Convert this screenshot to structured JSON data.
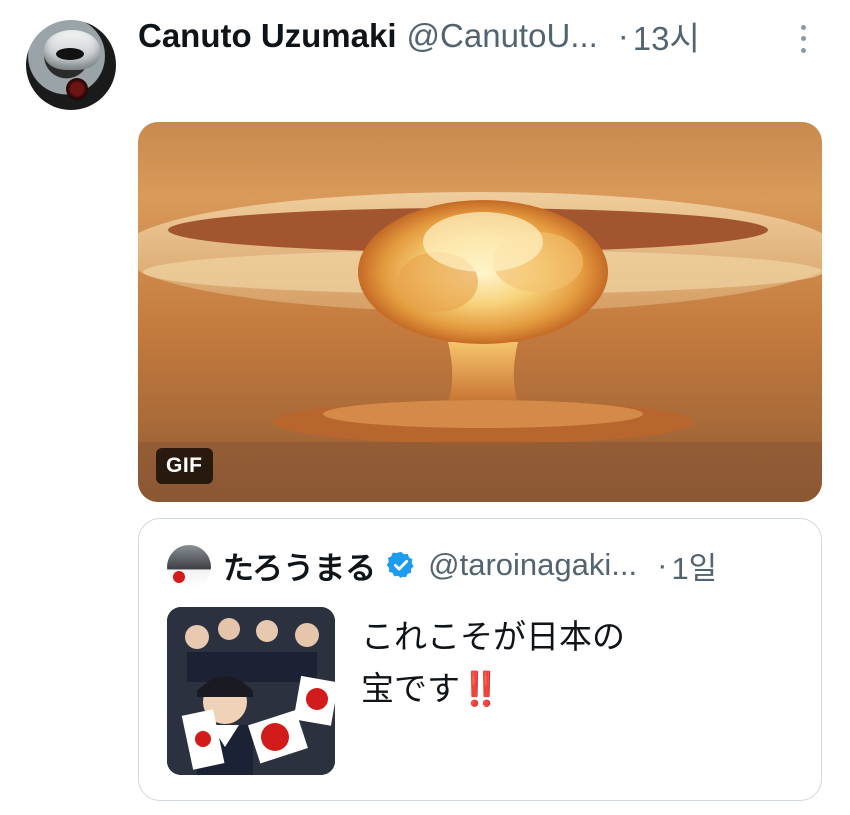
{
  "tweet": {
    "author_name": "Canuto Uzumaki",
    "author_handle": "@CanutoU...",
    "separator": "·",
    "time": "13시",
    "avatar_icon": "masked-face-avatar",
    "more_icon": "more-vertical-icon",
    "media": {
      "badge": "GIF",
      "icon": "mushroom-cloud-explosion-image"
    }
  },
  "quote": {
    "author_name": "たろうまる",
    "verified_icon": "verified-badge-icon",
    "verified_color": "#1d9bf0",
    "author_handle": "@taroinagaki...",
    "separator": "·",
    "time": "1일",
    "text_line1": "これこそが日本の",
    "text_line2": "宝です",
    "emphasis": "‼️",
    "thumbnail_icon": "children-with-flags-image"
  }
}
